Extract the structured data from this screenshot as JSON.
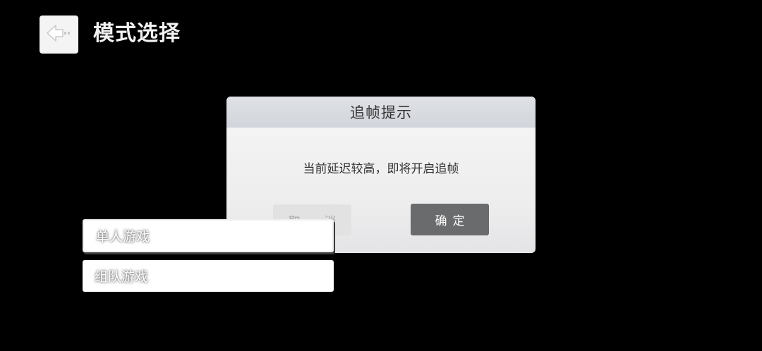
{
  "header": {
    "title": "模式选择",
    "back_icon": "back-arrow-icon"
  },
  "dialog": {
    "title": "追帧提示",
    "message": "当前延迟较高，即将开启追帧",
    "cancel_label": "取 消",
    "confirm_label": "确定"
  },
  "modes": [
    {
      "label": "单人游戏",
      "selected": true
    },
    {
      "label": "组队游戏",
      "selected": false
    }
  ],
  "colors": {
    "background": "#000000",
    "dialog_header": "#d2d5db",
    "confirm_button": "#6a6b6c",
    "cancel_button": "#e2e2e3"
  }
}
